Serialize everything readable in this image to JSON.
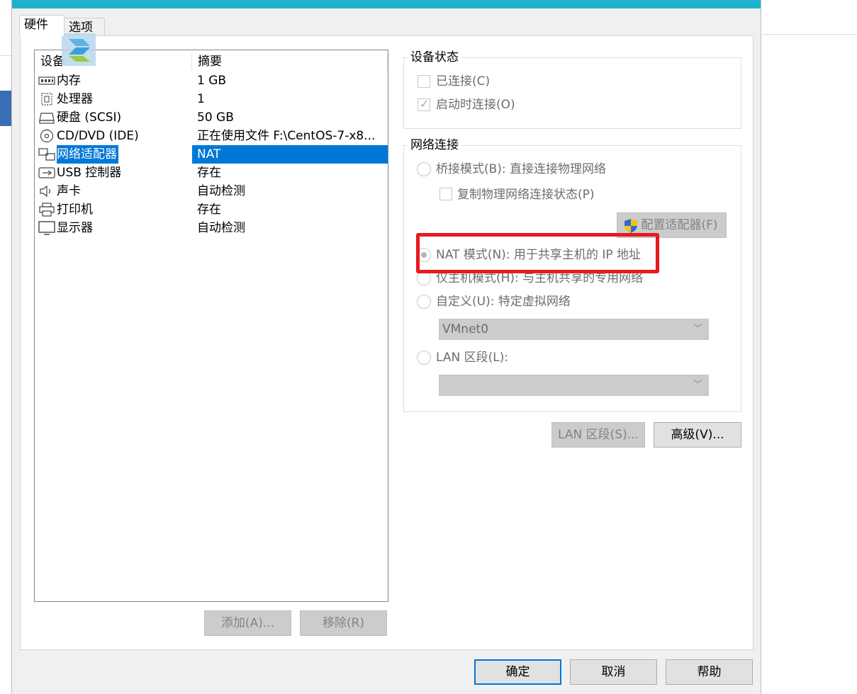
{
  "tabs": [
    {
      "label": "硬件"
    },
    {
      "label": "选项"
    }
  ],
  "device_list": {
    "headers": {
      "device": "设备",
      "summary": "摘要"
    },
    "rows": [
      {
        "icon": "memory-icon",
        "name": "内存",
        "summary": "1 GB"
      },
      {
        "icon": "processor-icon",
        "name": "处理器",
        "summary": "1"
      },
      {
        "icon": "harddisk-icon",
        "name": "硬盘 (SCSI)",
        "summary": "50 GB"
      },
      {
        "icon": "cd-dvd-icon",
        "name": "CD/DVD (IDE)",
        "summary": "正在使用文件 F:\\CentOS-7-x8..."
      },
      {
        "icon": "network-adapter-icon",
        "name": "网络适配器",
        "summary": "NAT",
        "selected": true
      },
      {
        "icon": "usb-icon",
        "name": "USB 控制器",
        "summary": "存在"
      },
      {
        "icon": "sound-icon",
        "name": "声卡",
        "summary": "自动检测"
      },
      {
        "icon": "printer-icon",
        "name": "打印机",
        "summary": "存在"
      },
      {
        "icon": "display-icon",
        "name": "显示器",
        "summary": "自动检测"
      }
    ],
    "add_button": "添加(A)...",
    "remove_button": "移除(R)"
  },
  "device_status": {
    "title": "设备状态",
    "connected": {
      "label": "已连接(C)",
      "checked": false
    },
    "connect_on_start": {
      "label": "启动时连接(O)",
      "checked": true
    }
  },
  "network": {
    "title": "网络连接",
    "bridged": {
      "label": "桥接模式(B): 直接连接物理网络",
      "selected": false
    },
    "replicate": {
      "label": "复制物理网络连接状态(P)",
      "checked": false
    },
    "configure_button": "配置适配器(F)",
    "nat": {
      "label": "NAT 模式(N): 用于共享主机的 IP 地址",
      "selected": true
    },
    "host_only": {
      "label": "仅主机模式(H): 与主机共享的专用网络",
      "selected": false
    },
    "custom": {
      "label": "自定义(U): 特定虚拟网络",
      "selected": false
    },
    "custom_select": "VMnet0",
    "lan_segment": {
      "label": "LAN 区段(L):",
      "selected": false
    },
    "lan_select": "",
    "lan_segments_button": "LAN 区段(S)...",
    "advanced_button": "高级(V)..."
  },
  "footer": {
    "ok": "确定",
    "cancel": "取消",
    "help": "帮助"
  },
  "colors": {
    "title_bar": "#1fb3c9",
    "selection": "#0078d7",
    "highlight_box": "#e8191f"
  }
}
